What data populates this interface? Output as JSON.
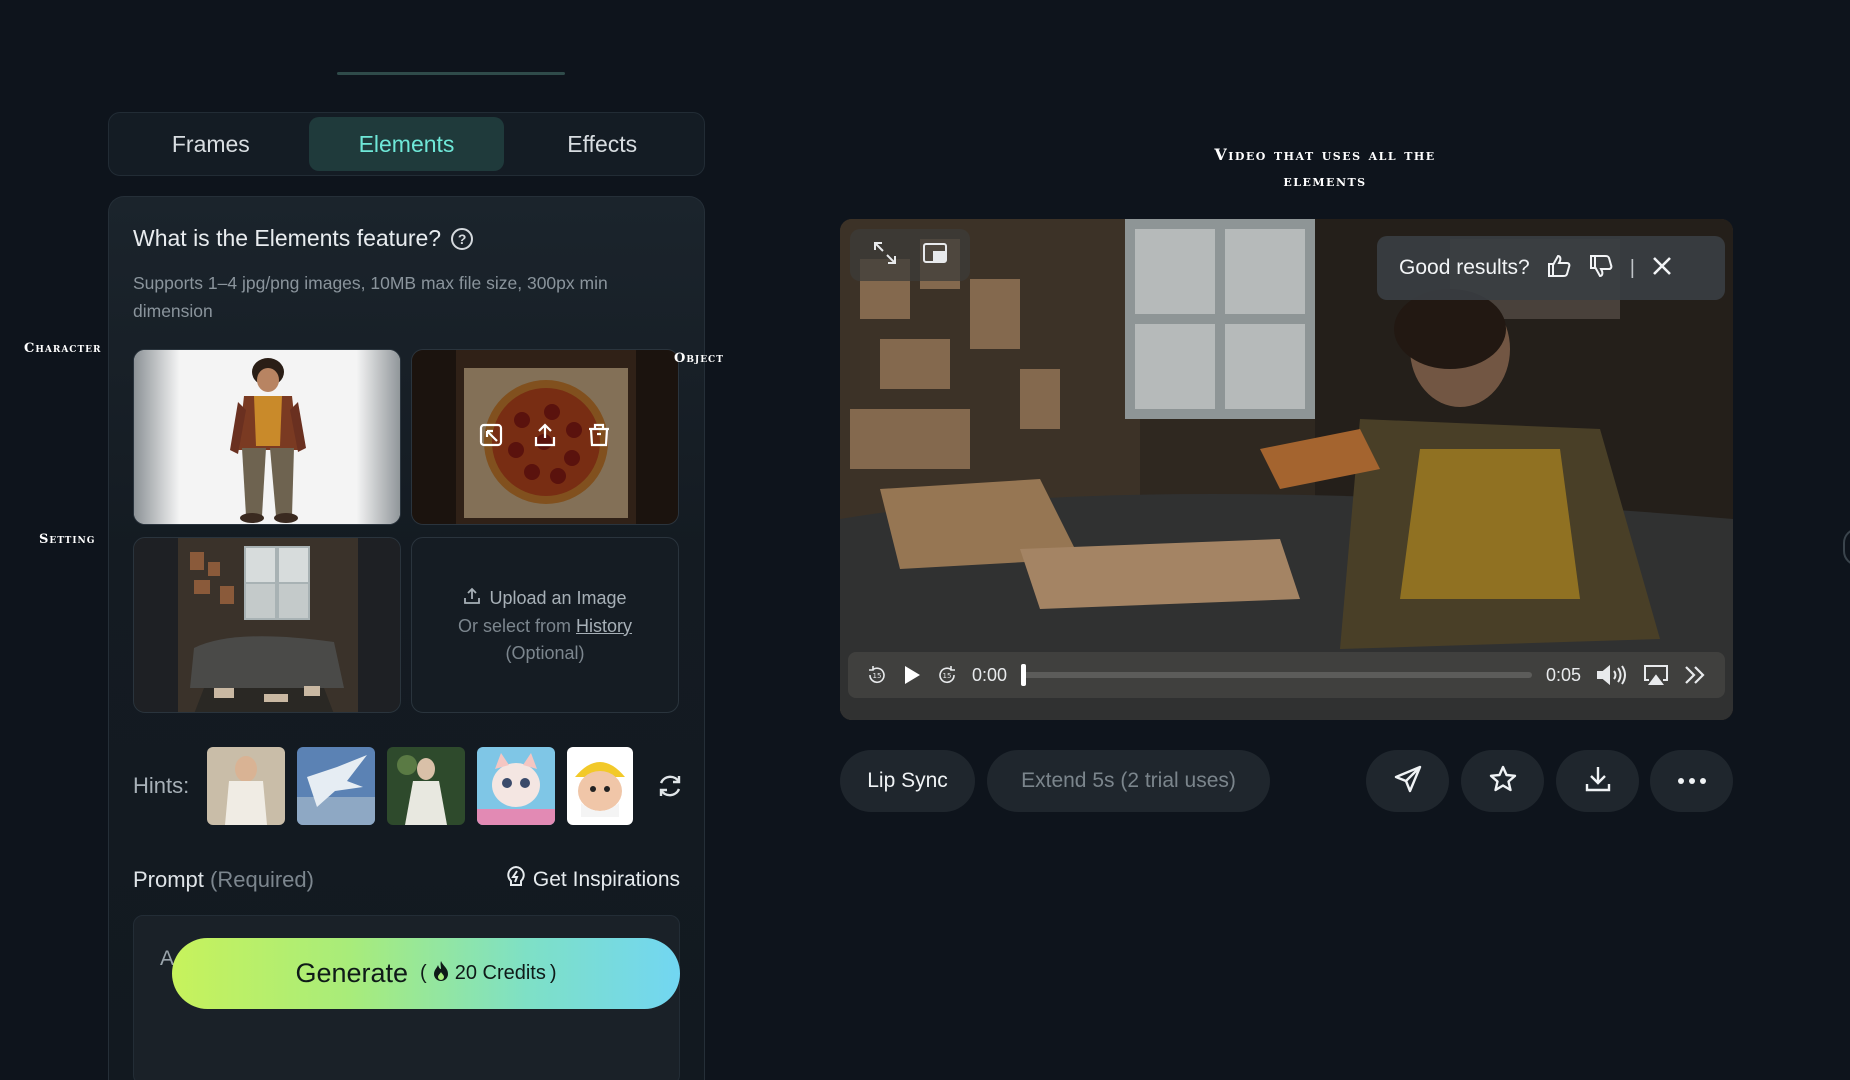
{
  "tabs": [
    {
      "label": "Frames"
    },
    {
      "label": "Elements"
    },
    {
      "label": "Effects"
    }
  ],
  "panel": {
    "title": "What is the Elements feature?",
    "description": "Supports 1–4 jpg/png images, 10MB max file size, 300px min dimension",
    "upload": {
      "line1": "Upload an Image",
      "line2_prefix": "Or select from ",
      "line2_link": "History",
      "line3": "(Optional)"
    },
    "hints_label": "Hints:",
    "prompt_label": "Prompt",
    "prompt_required": "(Required)",
    "inspirations_label": "Get Inspirations",
    "prompt_text": "A st",
    "generate_label": "Generate",
    "credits_open": "(",
    "credits_label": "20 Credits",
    "credits_close": ")"
  },
  "annotations": {
    "character": "Character",
    "object": "Object",
    "setting": "Setting",
    "video_caption": "Video that uses all the elements"
  },
  "video": {
    "feedback_label": "Good results?",
    "feedback_sep": "|",
    "time_current": "0:00",
    "time_total": "0:05",
    "progress": 0
  },
  "actions": {
    "lip_sync": "Lip Sync",
    "extend": "Extend 5s (2 trial uses)"
  },
  "colors": {
    "accent": "#6fe8d8",
    "background": "#0e141c",
    "generate_gradient_start": "#c7f25c",
    "generate_gradient_end": "#72d6f2"
  },
  "icons": [
    "help-icon",
    "upload-icon",
    "crop-icon",
    "share-icon",
    "trash-icon",
    "refresh-icon",
    "bulb-icon",
    "fire-icon",
    "expand-icon",
    "pip-icon",
    "thumbs-up-icon",
    "thumbs-down-icon",
    "close-icon",
    "rewind-icon",
    "play-icon",
    "forward-icon",
    "volume-icon",
    "airplay-icon",
    "chevron-double-right-icon",
    "send-icon",
    "star-icon",
    "download-icon",
    "more-icon"
  ]
}
